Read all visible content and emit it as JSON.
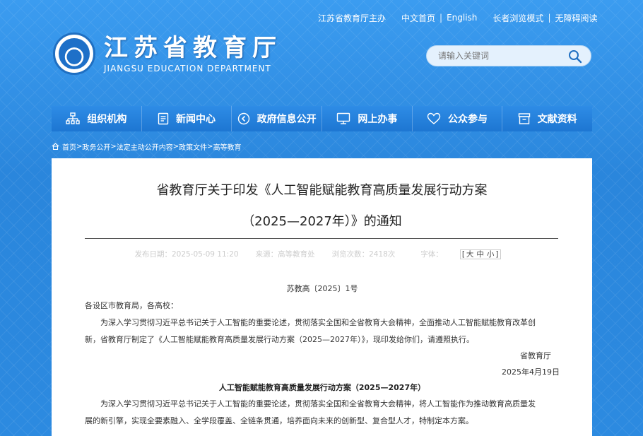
{
  "header": {
    "top_links": {
      "host": "江苏省教育厅主办",
      "chinese_home": "中文首页",
      "english": "English",
      "elder_mode": "长者浏览模式",
      "accessible": "无障碍阅读"
    },
    "logo": {
      "name_cn": "江苏省教育厅",
      "name_en": "JIANGSU EDUCATION DEPARTMENT"
    },
    "search": {
      "placeholder": "请输入关键词"
    }
  },
  "nav": {
    "items": [
      {
        "label": "组织机构",
        "icon": "org-chart-icon"
      },
      {
        "label": "新闻中心",
        "icon": "document-icon"
      },
      {
        "label": "政府信息公开",
        "icon": "share-icon"
      },
      {
        "label": "网上办事",
        "icon": "monitor-icon"
      },
      {
        "label": "公众参与",
        "icon": "heart-icon"
      },
      {
        "label": "文献资料",
        "icon": "archive-icon"
      }
    ]
  },
  "breadcrumb": {
    "items": [
      "首页",
      "政务公开",
      "法定主动公开内容",
      "政策文件",
      "高等教育"
    ],
    "separator": ">"
  },
  "article": {
    "title_line1": "省教育厅关于印发《人工智能赋能教育高质量发展行动方案",
    "title_line2": "（2025—2027年）》的通知",
    "meta": {
      "publish_date": "发布日期：2025-05-09 11:20",
      "source": "来源：高等教育处",
      "views": "浏览次数：2418次",
      "font_label": "字体：",
      "font_large": "大",
      "font_medium": "中",
      "font_small": "小"
    },
    "doc_number": "苏教高〔2025〕1号",
    "salutation": "各设区市教育局，各高校：",
    "paragraph1_line1": "为深入学习贯彻习近平总书记关于人工智能的重要论述，贯彻落实全国和全省教育大会精神，全面推动人工智能赋能教育改革创",
    "paragraph1_line2": "新，省教育厅制定了《人工智能赋能教育高质量发展行动方案（2025—2027年）》，现印发给你们，请遵照执行。",
    "signature": "省教育厅",
    "sign_date": "2025年4月19日",
    "plan_title": "人工智能赋能教育高质量发展行动方案（2025—2027年）",
    "paragraph2_line1": "为深入学习贯彻习近平总书记关于人工智能的重要论述，贯彻落实全国和全省教育大会精神，将人工智能作为推动教育高质量发",
    "paragraph2_line2": "展的新引擎，实现全要素融入、全学段覆盖、全链条贯通，培养面向未来的创新型、复合型人才，特制定本方案。"
  }
}
